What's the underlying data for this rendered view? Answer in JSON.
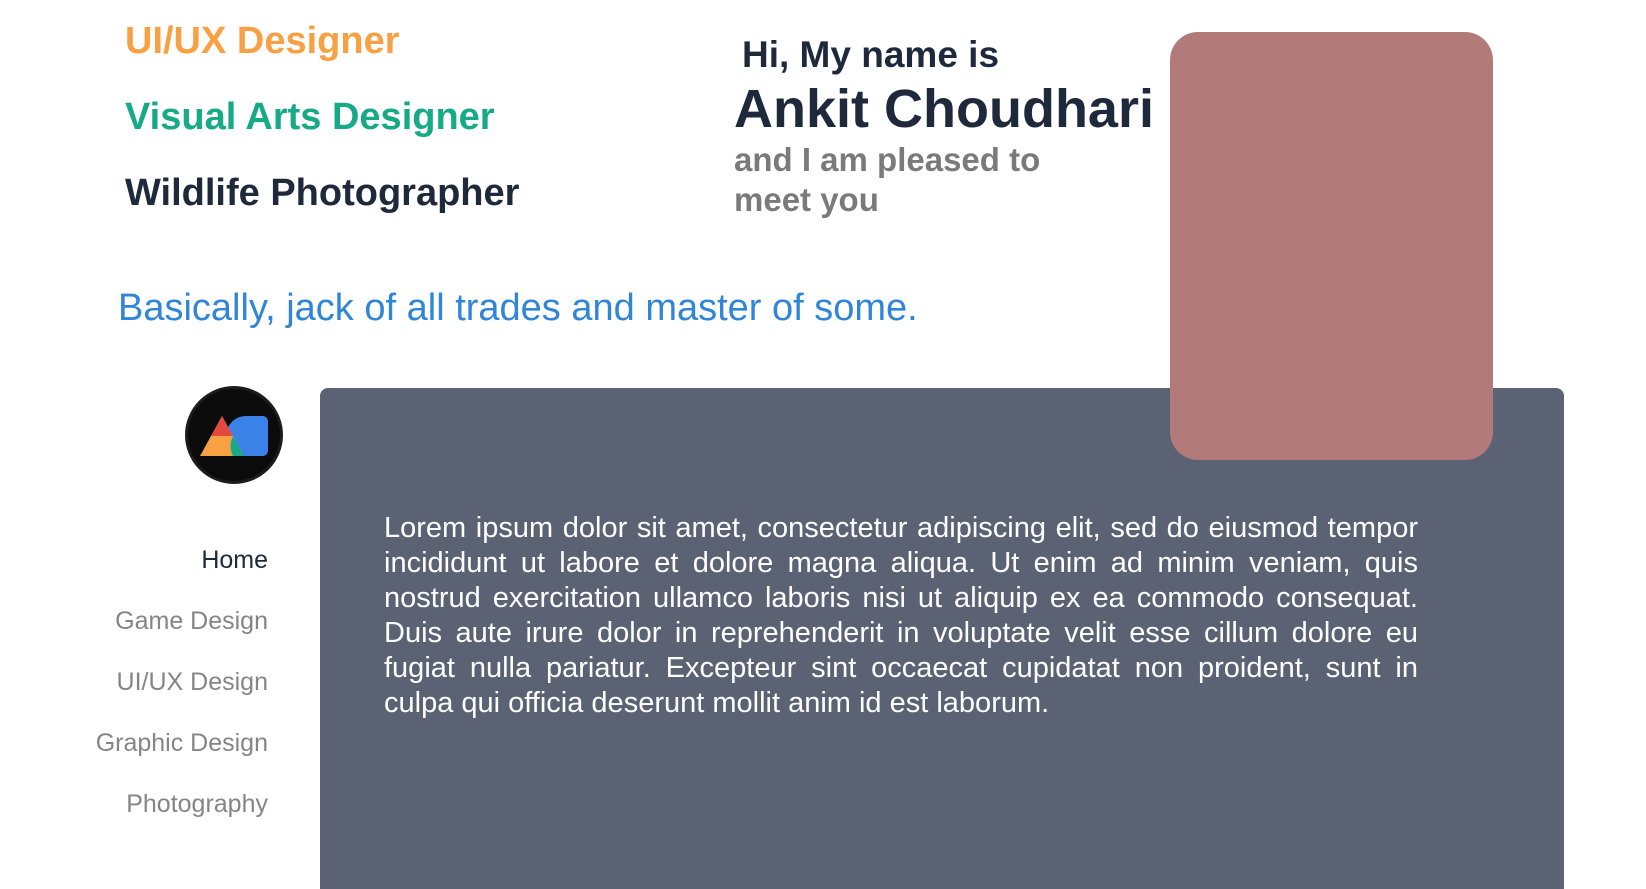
{
  "header": {
    "roles": [
      "UI/UX Designer",
      "Visual Arts Designer",
      "Wildlife Photographer"
    ],
    "greeting": "Hi, My name is",
    "name": "Ankit Choudhari",
    "subtitle": "and I am pleased to meet you",
    "tagline": "Basically, jack of all trades and master of some."
  },
  "logo": {
    "icon": "ac-monogram-logo-icon"
  },
  "nav": {
    "items": [
      {
        "label": "Home",
        "active": true
      },
      {
        "label": "Game Design",
        "active": false
      },
      {
        "label": "UI/UX Design",
        "active": false
      },
      {
        "label": "Graphic Design",
        "active": false
      },
      {
        "label": "Photography",
        "active": false
      }
    ]
  },
  "main": {
    "body_text": "Lorem ipsum dolor sit amet, consectetur adipiscing elit, sed do eiusmod tempor incididunt ut labore et dolore magna aliqua. Ut enim ad minim veniam, quis nostrud exercitation ullamco laboris nisi ut aliquip ex ea commodo consequat. Duis aute irure dolor in reprehenderit in voluptate velit esse cillum dolore eu fugiat nulla pariatur. Excepteur sint occaecat cupidatat non proident, sunt in culpa qui officia deserunt mollit anim id est laborum."
  },
  "colors": {
    "role_ui_ux": "#f7a044",
    "role_visual_arts": "#16ab86",
    "role_wildlife": "#1e293b",
    "tagline": "#2f86d8",
    "photo_placeholder": "#b27b7a",
    "panel": "#5a6274",
    "nav_active": "#1e293b",
    "nav_inactive": "#858585"
  }
}
